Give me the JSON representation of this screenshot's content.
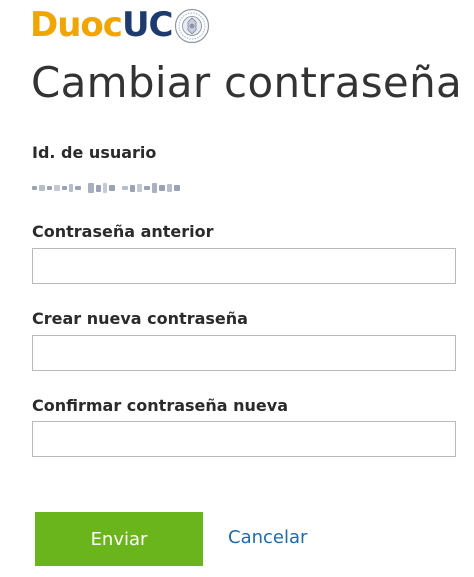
{
  "logo": {
    "brand_part1": "Duoc",
    "brand_part2": "UC",
    "brand_part1_color": "#f0a500",
    "brand_part2_color": "#1e3b6f"
  },
  "page": {
    "title": "Cambiar contraseña"
  },
  "user": {
    "id_label": "Id. de usuario",
    "id_value_obscured": true
  },
  "form": {
    "old_password_label": "Contraseña anterior",
    "old_password_value": "",
    "new_password_label": "Crear nueva contraseña",
    "new_password_value": "",
    "confirm_password_label": "Confirmar contraseña nueva",
    "confirm_password_value": ""
  },
  "actions": {
    "submit_label": "Enviar",
    "cancel_label": "Cancelar",
    "submit_color": "#6bb51c",
    "cancel_color": "#1f6aa8"
  }
}
